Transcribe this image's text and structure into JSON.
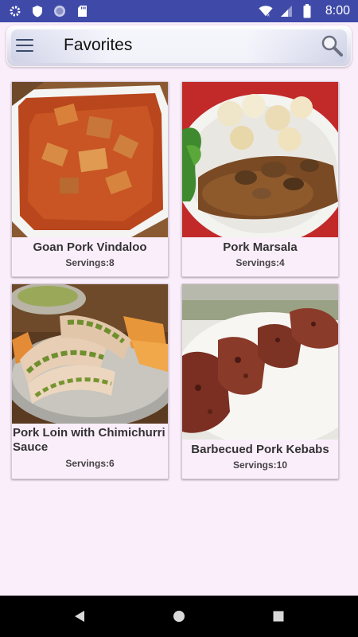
{
  "status_bar": {
    "time": "8:00",
    "left_icons": [
      "gear-icon",
      "shield-icon",
      "circle-icon",
      "sd-card-icon"
    ],
    "right_icons": [
      "wifi-icon",
      "signal-icon",
      "battery-icon"
    ]
  },
  "app_bar": {
    "title": "Favorites",
    "menu_icon": "hamburger-menu-icon",
    "search_icon": "search-icon"
  },
  "recipes": [
    {
      "title": "Goan Pork Vindaloo",
      "servings": "Servings:8"
    },
    {
      "title": "Pork Marsala",
      "servings": "Servings:4"
    },
    {
      "title": "Pork Loin with Chimichurri Sauce",
      "servings": "Servings:6"
    },
    {
      "title": "Barbecued Pork Kebabs",
      "servings": "Servings:10"
    }
  ],
  "nav_bar": {
    "icons": [
      "back-icon",
      "home-icon",
      "recents-icon"
    ]
  },
  "colors": {
    "status_bar": "#3f4aa8",
    "background": "#fbeefb",
    "nav_bar": "#000000"
  }
}
